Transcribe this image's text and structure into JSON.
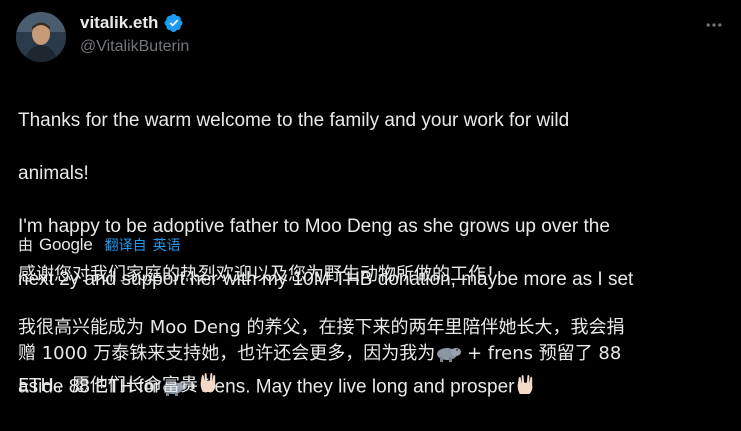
{
  "author": {
    "display_name": "vitalik.eth",
    "handle": "@VitalikButerin",
    "verified_icon": "verified-badge-icon",
    "accent": "#1d9bf0"
  },
  "menu": {
    "icon": "more-icon"
  },
  "tweet": {
    "line1": "Thanks for the warm welcome to the family and your work for wild",
    "line2": "animals!",
    "line3": "I'm happy to be adoptive father to Moo Deng as she grows up over the",
    "line4": "next 2y and support her with my 10M THB donation, maybe more as I set",
    "line5_a": "aside 88 ETH for",
    "line5_b": "+ frens. May they live long and prosper",
    "emoji_hippo": "hippopotamus-emoji",
    "emoji_hand": "vulcan-salute-emoji"
  },
  "translation": {
    "by_label": "由",
    "provider": "Google",
    "link_label": "翻译自",
    "source_language": "英语",
    "paragraph1": "感谢您对我们家庭的热烈欢迎以及您为野生动物所做的工作！",
    "paragraph2_a": "我很高兴能成为 Moo Deng 的养父，在接下来的两年里陪伴她长大，我会捐",
    "paragraph2_b": "赠 1000 万泰铢来支持她，也许还会更多，因为我为",
    "paragraph2_c": " + frens 预留了 88",
    "paragraph2_d": "ETH。愿他们长命富贵"
  }
}
